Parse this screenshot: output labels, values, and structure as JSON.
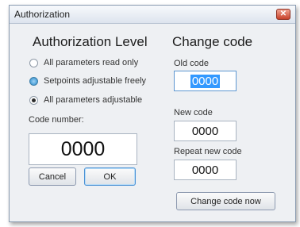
{
  "window": {
    "title": "Authorization",
    "close_glyph": "✕"
  },
  "left": {
    "heading": "Authorization Level",
    "options": [
      {
        "label": "All parameters read only",
        "checked": false
      },
      {
        "label": "Setpoints adjustable freely",
        "checked": false
      },
      {
        "label": "All parameters adjustable",
        "checked": true
      }
    ],
    "code_label": "Code number:",
    "code_value": "0000",
    "cancel_label": "Cancel",
    "ok_label": "OK"
  },
  "right": {
    "heading": "Change code",
    "old_label": "Old code",
    "old_value": "0000",
    "new_label": "New code",
    "new_value": "0000",
    "repeat_label": "Repeat new code",
    "repeat_value": "0000",
    "change_button": "Change code now"
  }
}
